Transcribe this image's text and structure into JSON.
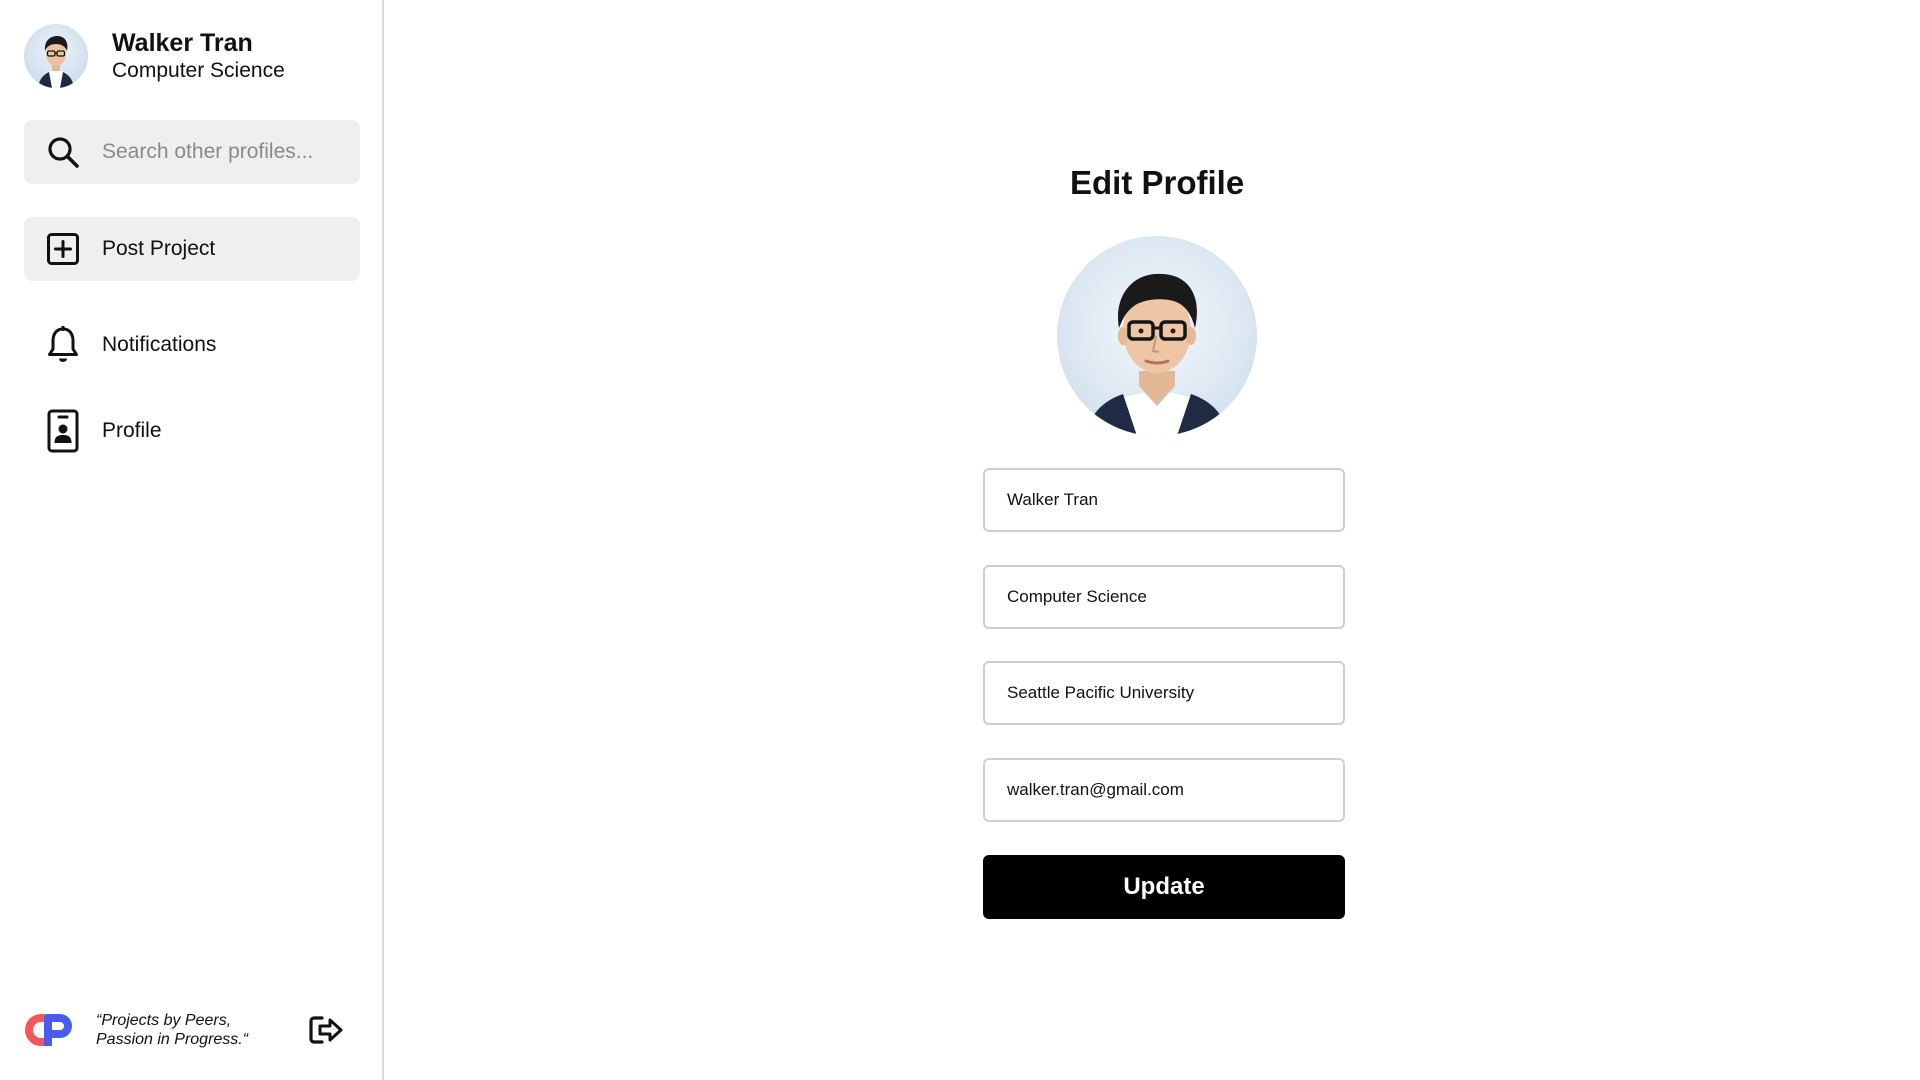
{
  "user": {
    "name": "Walker Tran",
    "major": "Computer Science"
  },
  "sidebar": {
    "search": {
      "placeholder": "Search other profiles...",
      "icon": "search-icon"
    },
    "items": [
      {
        "label": "Post Project",
        "icon": "plus-square-icon"
      },
      {
        "label": "Notifications",
        "icon": "bell-icon"
      },
      {
        "label": "Profile",
        "icon": "id-badge-icon"
      }
    ],
    "footer": {
      "tagline_line1": "“Projects by Peers,",
      "tagline_line2": "Passion in Progress.“",
      "logo_icon": "app-logo",
      "logout_icon": "logout-icon"
    }
  },
  "main": {
    "title": "Edit Profile",
    "fields": {
      "name": "Walker Tran",
      "major": "Computer Science",
      "school": "Seattle Pacific University",
      "email": "walker.tran@gmail.com"
    },
    "update_label": "Update"
  },
  "colors": {
    "sidebar_item_bg": "#efefef",
    "button_bg": "#000000",
    "logo_red": "#f2575a",
    "logo_blue": "#4a5cf0",
    "border": "#cfcfcf"
  }
}
